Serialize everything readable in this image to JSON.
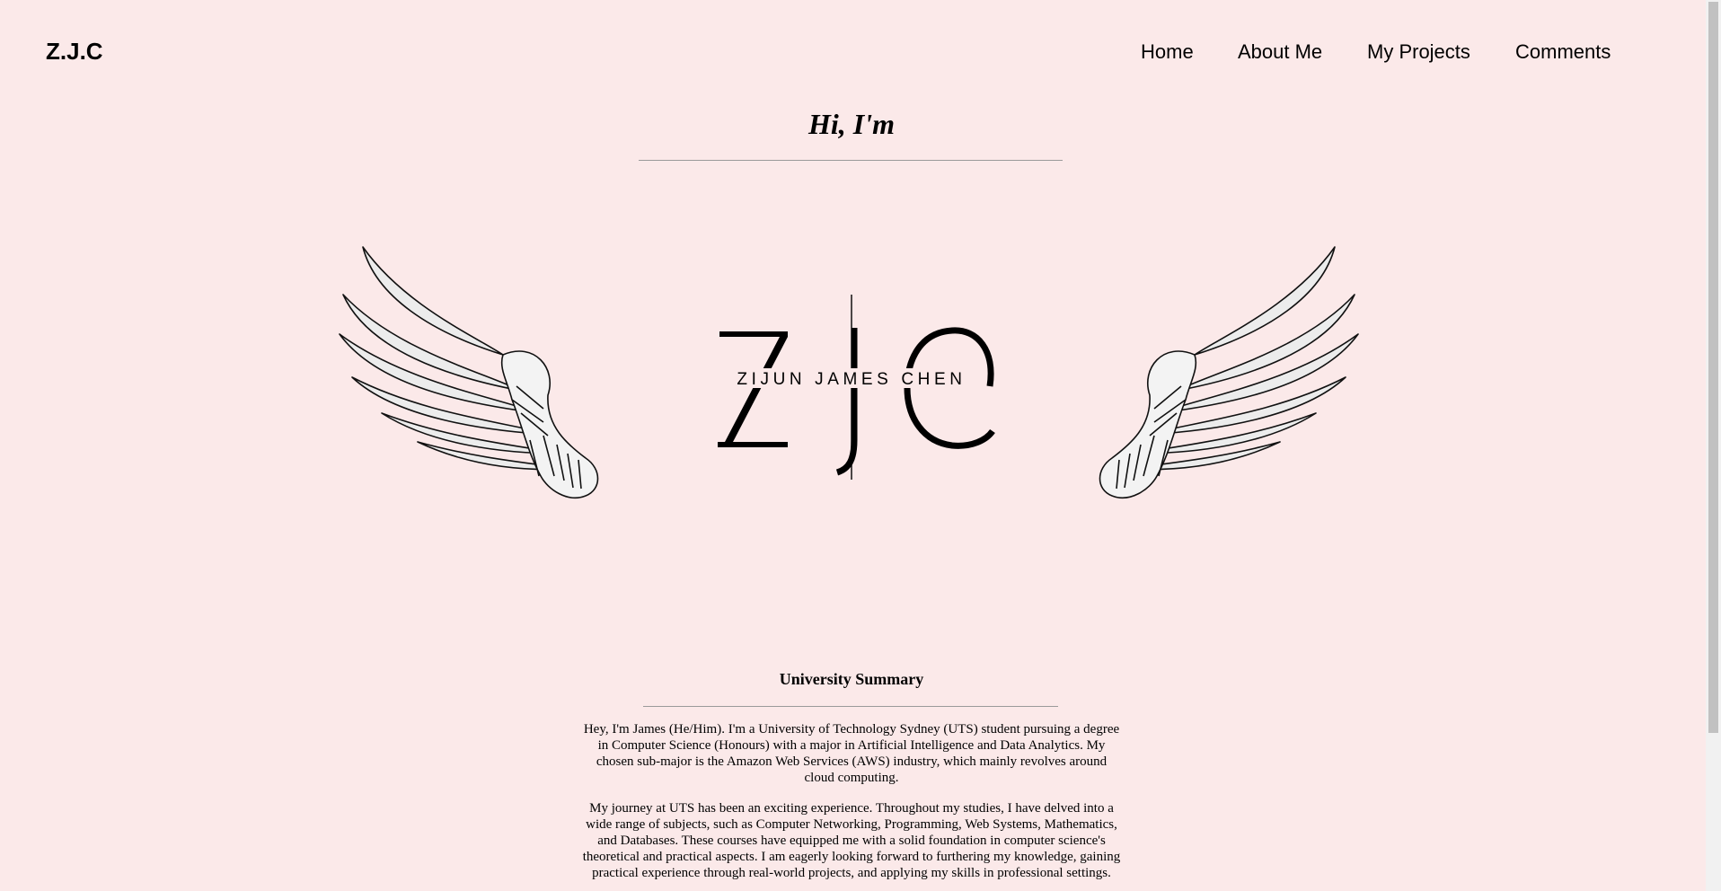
{
  "header": {
    "brand": "Z.J.C",
    "nav": [
      {
        "label": "Home"
      },
      {
        "label": "About Me"
      },
      {
        "label": "My Projects"
      },
      {
        "label": "Comments"
      }
    ]
  },
  "hero": {
    "greeting": "Hi, I'm",
    "logo": {
      "monogram": "ZJC",
      "name": "ZIJUN JAMES CHEN"
    }
  },
  "summary": {
    "title": "University Summary",
    "paragraphs": [
      "Hey, I'm James (He/Him). I'm a University of Technology Sydney (UTS) student pursuing a degree in Computer Science (Honours) with a major in Artificial Intelligence and Data Analytics. My chosen sub-major is the Amazon Web Services (AWS) industry, which mainly revolves around cloud computing.",
      "My journey at UTS has been an exciting experience. Throughout my studies, I have delved into a wide range of subjects, such as Computer Networking, Programming, Web Systems, Mathematics, and Databases. These courses have equipped me with a solid foundation in computer science's theoretical and practical aspects. I am eagerly looking forward to furthering my knowledge, gaining practical experience through real-world projects, and applying my skills in professional settings."
    ]
  },
  "colors": {
    "background": "#fbe9e9",
    "text": "#000000",
    "rule": "#9a9a9a"
  }
}
